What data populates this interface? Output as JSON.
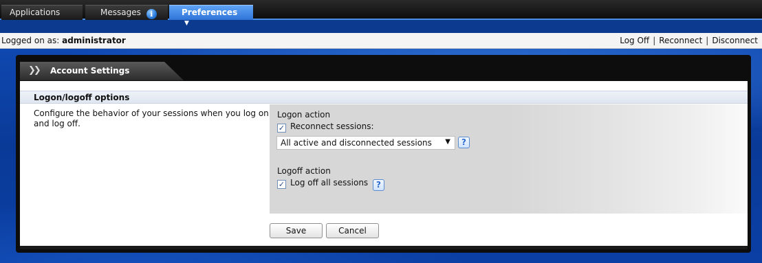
{
  "nav": {
    "tabs": [
      {
        "label": "Applications"
      },
      {
        "label": "Messages"
      },
      {
        "label": "Preferences"
      }
    ]
  },
  "logon": {
    "prefix": "Logged on as: ",
    "user": "administrator",
    "links": [
      "Log Off",
      "Reconnect",
      "Disconnect"
    ]
  },
  "panel": {
    "tab_title": "Account Settings",
    "section_title": "Logon/logoff options",
    "description": "Configure the behavior of your sessions when you log on and log off.",
    "logon_action_label": "Logon action",
    "reconnect_label": "Reconnect sessions:",
    "reconnect_checked": true,
    "reconnect_select_value": "All active and disconnected sessions",
    "logoff_action_label": "Logoff action",
    "logoff_all_label": "Log off all sessions",
    "logoff_all_checked": true,
    "help_symbol": "?"
  },
  "buttons": {
    "save": "Save",
    "cancel": "Cancel"
  },
  "colors": {
    "accent": "#2f74d8",
    "background": "#0b3a8e"
  }
}
